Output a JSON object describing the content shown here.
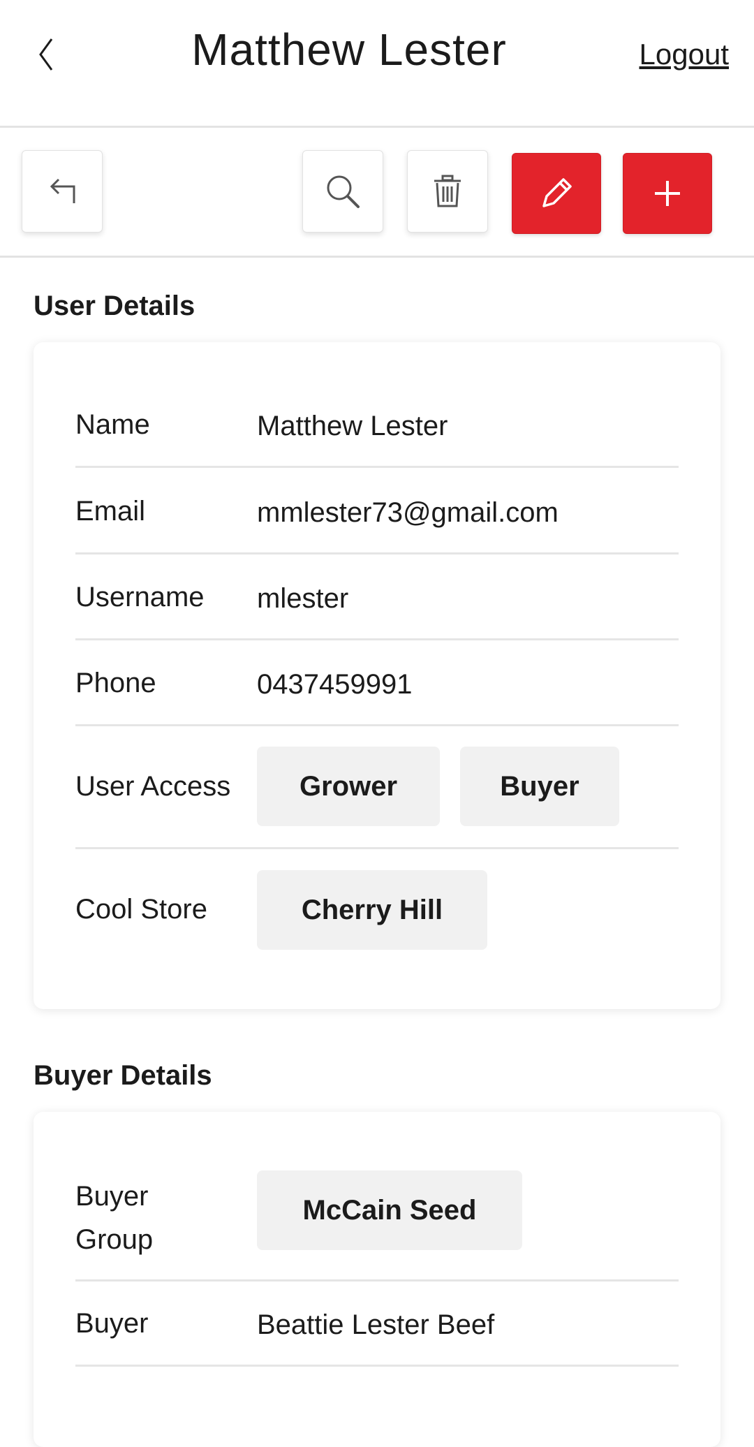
{
  "header": {
    "title": "Matthew Lester",
    "logout_label": "Logout"
  },
  "toolbar": {
    "icons": [
      "return-icon",
      "search-icon",
      "trash-icon",
      "pencil-icon",
      "plus-icon"
    ],
    "accent_color": "#e3232b"
  },
  "user_details": {
    "section_title": "User Details",
    "rows": [
      {
        "label": "Name",
        "value": "Matthew Lester"
      },
      {
        "label": "Email",
        "value": "mmlester73@gmail.com"
      },
      {
        "label": "Username",
        "value": "mlester"
      },
      {
        "label": "Phone",
        "value": "0437459991"
      }
    ],
    "user_access": {
      "label": "User Access",
      "chips": [
        "Grower",
        "Buyer"
      ]
    },
    "cool_store": {
      "label": "Cool Store",
      "chips": [
        "Cherry Hill"
      ]
    }
  },
  "buyer_details": {
    "section_title": "Buyer Details",
    "buyer_group": {
      "label": "Buyer Group",
      "chip": "McCain Seed"
    },
    "buyer": {
      "label": "Buyer",
      "value": "Beattie Lester Beef"
    }
  }
}
